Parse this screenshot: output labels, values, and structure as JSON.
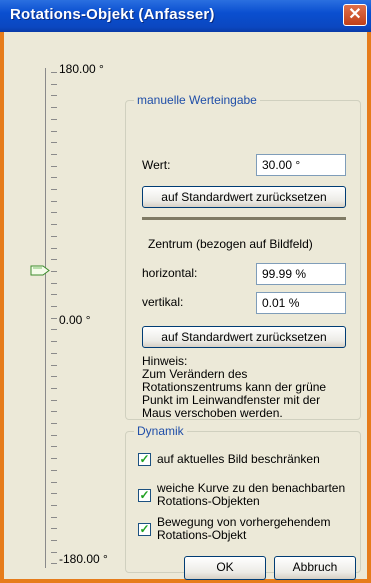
{
  "window": {
    "title": "Rotations-Objekt (Anfasser)",
    "close_glyph": "✕",
    "frame_color": "#e67c1b",
    "title_color": "#0b4fd0"
  },
  "slider": {
    "max_label": "180.00 °",
    "mid_label": "0.00 °",
    "min_label": "-180.00 °",
    "value": 30.0,
    "range": [
      -180,
      180
    ]
  },
  "manual": {
    "legend": "manuelle Werteingabe",
    "value_label": "Wert:",
    "value": "30.00 °",
    "reset_button": "auf Standardwert zurücksetzen",
    "center_heading": "Zentrum (bezogen auf Bildfeld)",
    "horizontal_label": "horizontal:",
    "horizontal_value": "99.99 %",
    "vertical_label": "vertikal:",
    "vertical_value": "0.01 %",
    "reset_button2": "auf Standardwert zurücksetzen",
    "hint_lines": [
      "Hinweis:",
      "Zum Verändern des",
      "Rotationszentrums kann der grüne",
      "Punkt  im Leinwandfenster mit der",
      "Maus verschoben werden."
    ]
  },
  "dynamik": {
    "legend": "Dynamik",
    "options": [
      {
        "label_lines": [
          "auf aktuelles Bild beschränken"
        ],
        "checked": true
      },
      {
        "label_lines": [
          "weiche Kurve zu den benachbarten",
          "Rotations-Objekten"
        ],
        "checked": true
      },
      {
        "label_lines": [
          "Bewegung von vorhergehendem",
          "Rotations-Objekt"
        ],
        "checked": true
      }
    ],
    "check_color": "#21a121"
  },
  "footer": {
    "ok": "OK",
    "cancel": "Abbruch"
  }
}
